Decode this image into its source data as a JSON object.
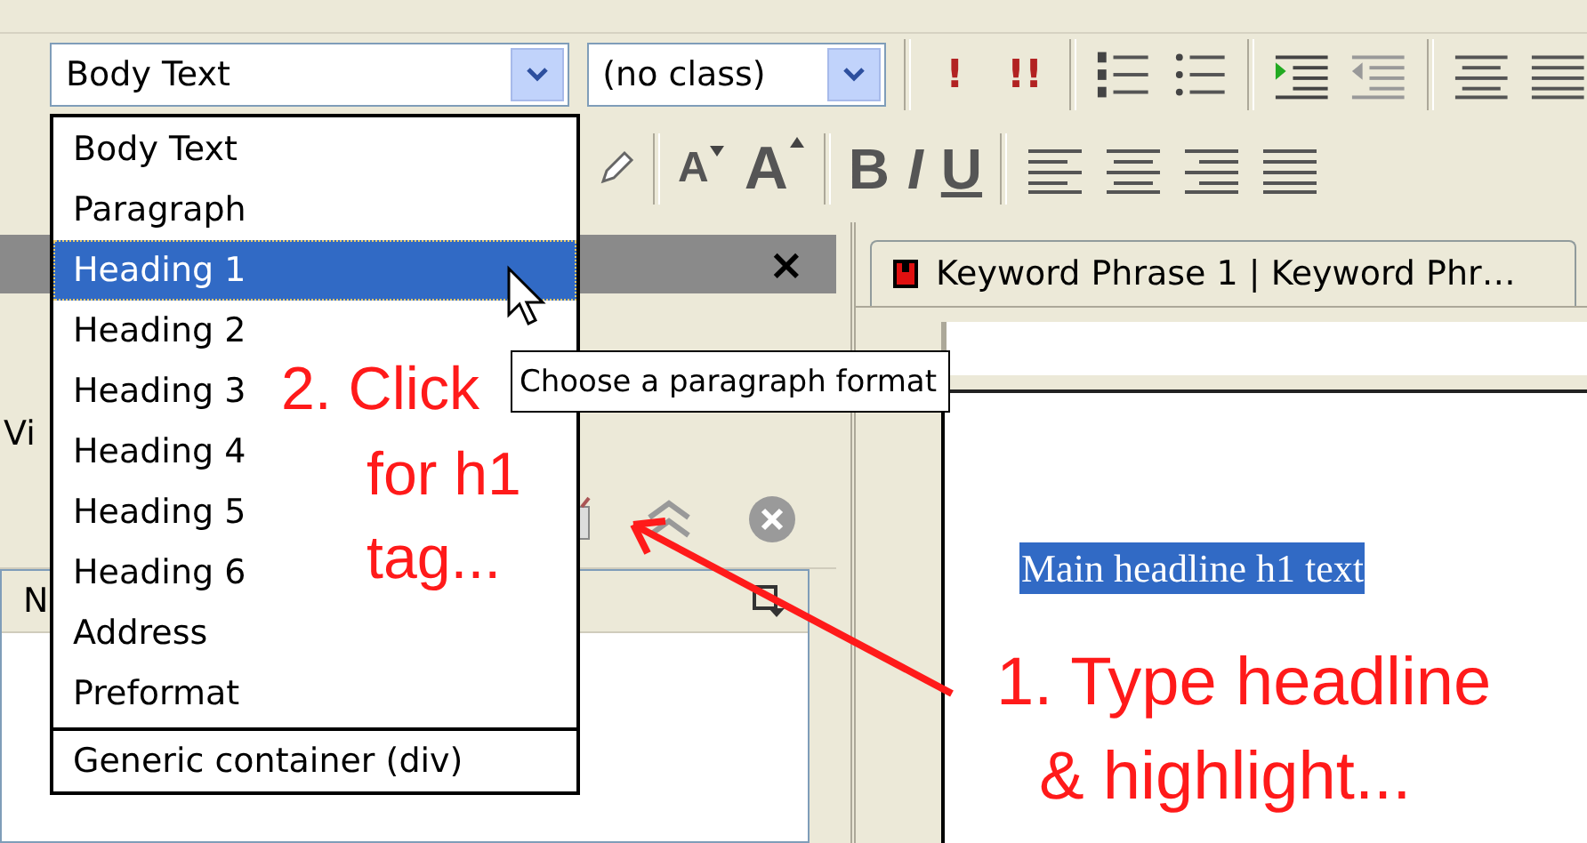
{
  "toolbar": {
    "style_select": {
      "value": "Body Text"
    },
    "class_select": {
      "value": "(no class)"
    },
    "buttons": [
      {
        "label": "!"
      },
      {
        "label": "!!"
      }
    ]
  },
  "format_toolbar": {
    "font_buttons": [
      {
        "label": "A",
        "kind": "smaller"
      },
      {
        "label": "A",
        "kind": "larger"
      }
    ],
    "style_buttons": [
      {
        "label": "B",
        "kind": "bold"
      },
      {
        "label": "I",
        "kind": "italic"
      },
      {
        "label": "U",
        "kind": "underline"
      }
    ]
  },
  "left_panel": {
    "close": "×",
    "partial_label": "Vi",
    "column_header": "N"
  },
  "style_menu": {
    "items": [
      {
        "label": "Body Text",
        "selected": false
      },
      {
        "label": "Paragraph",
        "selected": false
      },
      {
        "label": "Heading 1",
        "selected": true
      },
      {
        "label": "Heading 2",
        "selected": false
      },
      {
        "label": "Heading 3",
        "selected": false
      },
      {
        "label": "Heading 4",
        "selected": false
      },
      {
        "label": "Heading 5",
        "selected": false
      },
      {
        "label": "Heading 6",
        "selected": false
      },
      {
        "label": "Address",
        "selected": false
      },
      {
        "label": "Preformat",
        "selected": false
      }
    ],
    "footer_item": {
      "label": "Generic container (div)",
      "selected": false
    }
  },
  "tooltip": "Choose a paragraph format",
  "editor": {
    "tab": {
      "label": "Keyword Phrase 1 | Keyword Phr…",
      "selected": true
    },
    "headline": "Main headline h1 text",
    "headline_selected": true
  },
  "annotations": [
    {
      "kind": "click",
      "lines": [
        "2. Click",
        "for h1",
        "tag..."
      ]
    },
    {
      "kind": "type",
      "lines": [
        "1. Type headline",
        "& highlight..."
      ]
    }
  ]
}
